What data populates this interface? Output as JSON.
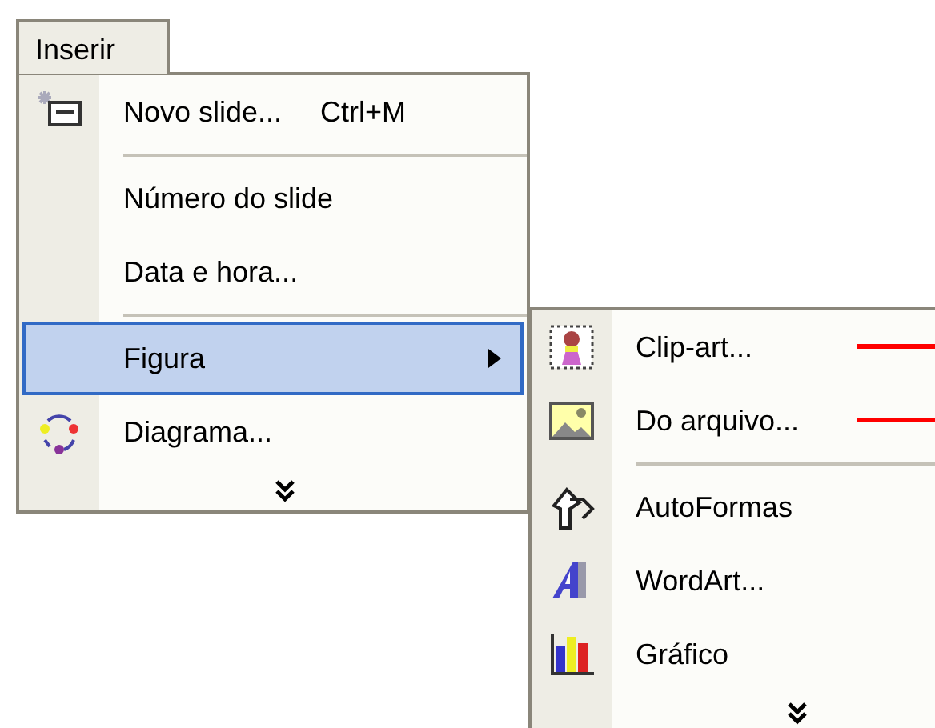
{
  "menu_title": {
    "label": "Inserir"
  },
  "menu": {
    "items": [
      {
        "kind": "command",
        "label": "Novo slide...",
        "shortcut": "Ctrl+M",
        "selected": false
      },
      {
        "kind": "separator"
      },
      {
        "kind": "command",
        "label": "Número do slide",
        "selected": false
      },
      {
        "kind": "command",
        "label": "Data e hora...",
        "selected": false
      },
      {
        "kind": "separator"
      },
      {
        "kind": "submenu",
        "label": "Figura",
        "selected": true
      },
      {
        "kind": "command",
        "label": "Diagrama...",
        "selected": false
      },
      {
        "kind": "more"
      }
    ]
  },
  "submenu": {
    "items": [
      {
        "kind": "command",
        "label": "Clip-art...",
        "selected": false,
        "annotated": true
      },
      {
        "kind": "command",
        "label": "Do arquivo...",
        "selected": false,
        "annotated": true
      },
      {
        "kind": "separator"
      },
      {
        "kind": "command",
        "label": "AutoFormas",
        "selected": false,
        "annotated": false
      },
      {
        "kind": "command",
        "label": "WordArt...",
        "selected": false,
        "annotated": false
      },
      {
        "kind": "command",
        "label": "Gráfico",
        "selected": false,
        "annotated": false
      },
      {
        "kind": "more"
      }
    ]
  }
}
